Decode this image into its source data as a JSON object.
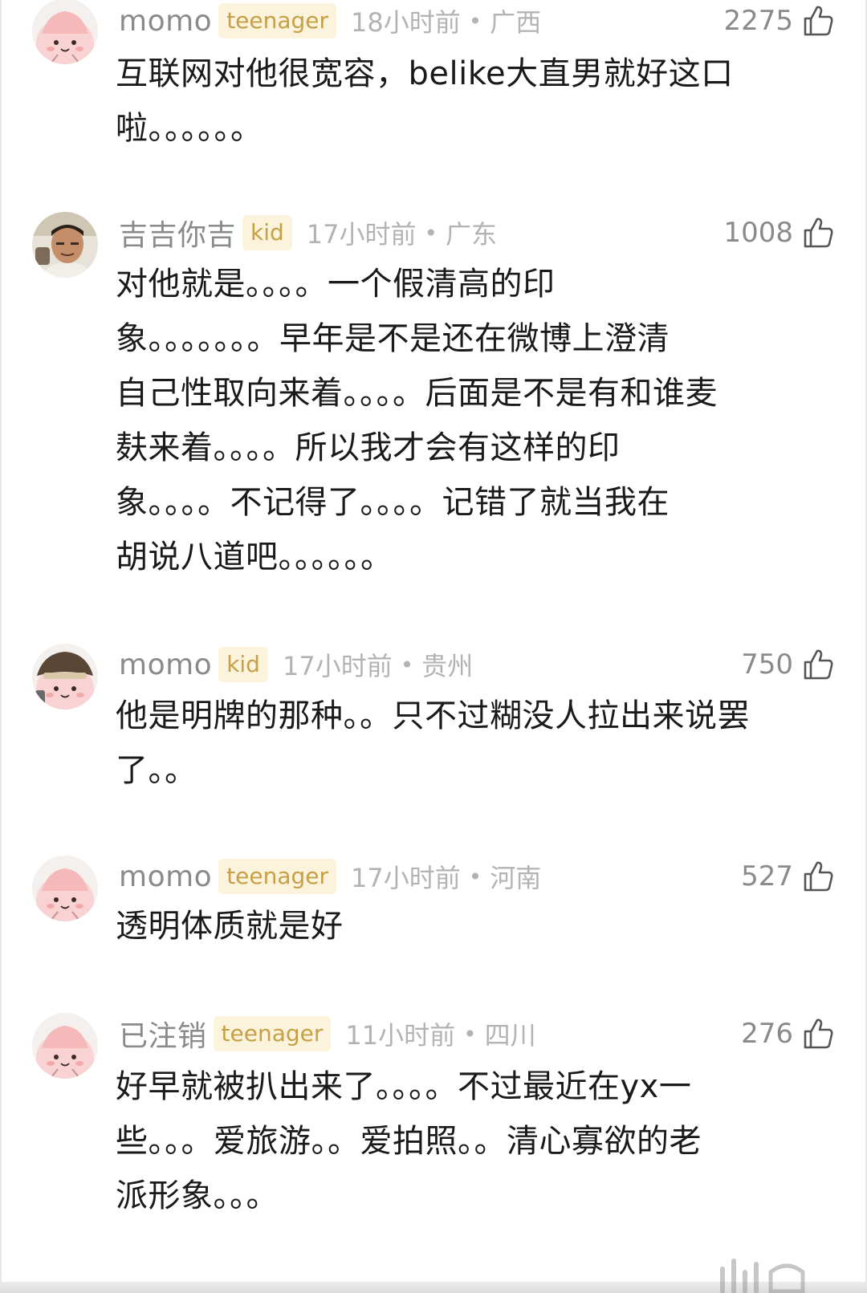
{
  "comments": [
    {
      "username": "momo",
      "badge": "teenager",
      "time": "18小时前",
      "separator": "•",
      "location": "广西",
      "likes": "2275",
      "avatar": "pink-cartoon-avatar",
      "lines": [
        "互联网对他很宽容，belike大直男就好这口",
        "啦。。。。。。"
      ]
    },
    {
      "username": "吉吉你吉",
      "badge": "kid",
      "time": "17小时前",
      "separator": "•",
      "location": "广东",
      "likes": "1008",
      "avatar": "photo-man-avatar",
      "lines": [
        "对他就是。。。。一个假清高的印",
        "象。。。。。。。早年是不是还在微博上澄清",
        "自己性取向来着。。。。后面是不是有和谁麦",
        "麸来着。。。。所以我才会有这样的印",
        "象。。。。不记得了。。。。记错了就当我在",
        "胡说八道吧。。。。。。"
      ]
    },
    {
      "username": "momo",
      "badge": "kid",
      "time": "17小时前",
      "separator": "•",
      "location": "贵州",
      "likes": "750",
      "avatar": "cartoon-hat-avatar",
      "lines": [
        "他是明牌的那种。。只不过糊没人拉出来说罢",
        "了。。"
      ]
    },
    {
      "username": "momo",
      "badge": "teenager",
      "time": "17小时前",
      "separator": "•",
      "location": "河南",
      "likes": "527",
      "avatar": "pink-cartoon-avatar",
      "lines": [
        "透明体质就是好"
      ]
    },
    {
      "username": "已注销",
      "badge": "teenager",
      "time": "11小时前",
      "separator": "•",
      "location": "四川",
      "likes": "276",
      "avatar": "pink-cartoon-avatar",
      "lines": [
        "好早就被扒出来了。。。。不过最近在yx一",
        "些。。。爱旅游。。爱拍照。。清心寡欲的老",
        "派形象。。。"
      ]
    }
  ],
  "colors": {
    "username": "#8a8a8a",
    "badge_text": "#c6a046",
    "badge_bg": "#fbf3dc",
    "meta": "#b3b3b3",
    "body_text": "#1a1a1a",
    "avatar_pink": "#f7c6c6"
  },
  "icons": {
    "like": "thumbs-up-icon"
  }
}
